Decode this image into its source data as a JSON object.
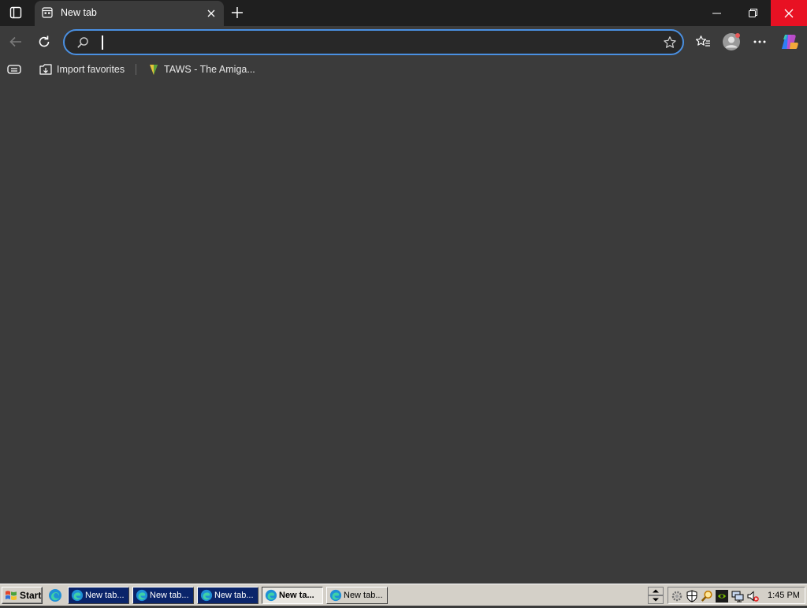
{
  "browser": {
    "tab": {
      "title": "New tab",
      "favicon": "newtab-page-icon",
      "close_icon": "close-icon"
    },
    "new_tab_icon": "plus-icon",
    "tab_actions_icon": "tab-actions-icon",
    "window_controls": {
      "minimize": "minimize-icon",
      "restore": "restore-icon",
      "close": "close-icon",
      "close_color": "#e81123"
    }
  },
  "toolbar": {
    "back_icon": "back-arrow-icon",
    "refresh_icon": "refresh-icon",
    "address": {
      "value": "",
      "placeholder": "",
      "search_icon": "search-icon",
      "favorite_icon": "star-icon",
      "focus_color": "#4a90e2"
    },
    "favorites_icon": "favorites-icon",
    "profile_icon": "profile-avatar-icon",
    "menu_icon": "more-icon",
    "copilot_icon": "copilot-icon"
  },
  "favorites_bar": {
    "items": [
      {
        "label": "Import favorites",
        "icon": "import-favorites-icon"
      },
      {
        "label": "TAWS - The Amiga...",
        "icon": "taws-site-icon"
      }
    ],
    "leading_icon": "reading-list-icon"
  },
  "taskbar": {
    "start_label": "Start",
    "quick_launch": [
      {
        "icon": "edge-icon"
      }
    ],
    "tasks": [
      {
        "label": "New tab...",
        "state": "inactive-dark"
      },
      {
        "label": "New tab...",
        "state": "inactive-dark"
      },
      {
        "label": "New tab...",
        "state": "inactive-dark"
      },
      {
        "label": "New ta...",
        "state": "active"
      },
      {
        "label": "New tab...",
        "state": "normal"
      }
    ],
    "tray_icons": [
      "settings-gear-icon",
      "shield-icon",
      "search-magnifier-icon",
      "nvidia-icon",
      "network-icon",
      "volume-muted-icon"
    ],
    "clock": "1:45 PM"
  },
  "colors": {
    "titlebar": "#1f1f1f",
    "content": "#3b3b3b",
    "taskbar": "#d4d0c8",
    "taskbar_active_dark": "#0a246a"
  }
}
